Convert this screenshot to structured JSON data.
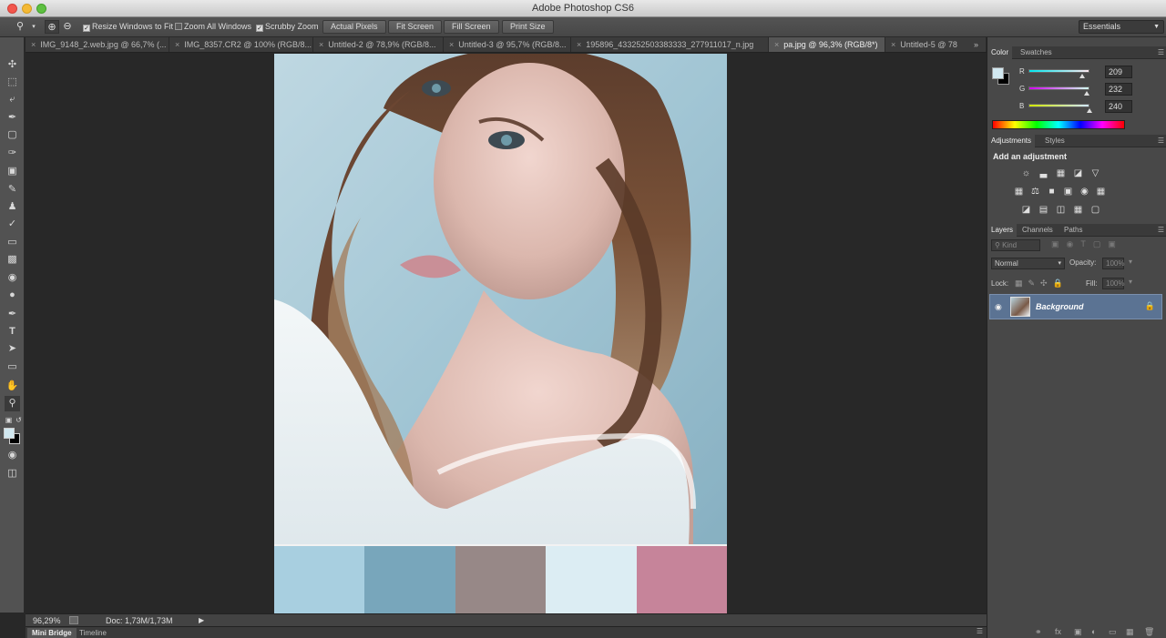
{
  "window": {
    "title": "Adobe Photoshop CS6"
  },
  "options": {
    "resize_windows": "Resize Windows to Fit",
    "zoom_all_windows": "Zoom All Windows",
    "scrubby_zoom": "Scrubby Zoom",
    "actual_pixels": "Actual Pixels",
    "fit_screen": "Fit Screen",
    "fill_screen": "Fill Screen",
    "print_size": "Print Size",
    "workspace": "Essentials"
  },
  "tabs": [
    "IMG_9148_2.web.jpg @ 66,7% (...",
    "IMG_8357.CR2 @ 100% (RGB/8...",
    "Untitled-2 @ 78,9% (RGB/8...",
    "Untitled-3 @ 95,7% (RGB/8...",
    "195896_433252503383333_277911017_n.jpg",
    "pa.jpg @ 96,3% (RGB/8*)",
    "Untitled-5 @ 78"
  ],
  "tabs_overflow": "»",
  "palette": {
    "colors": [
      "#a8cfe0",
      "#78a6bb",
      "#978887",
      "#dcedf3",
      "#c6849a"
    ]
  },
  "status": {
    "zoom": "96,29%",
    "doc": "Doc: 1,73M/1,73M"
  },
  "bottom_tabs": [
    "Mini Bridge",
    "Timeline"
  ],
  "color_panel": {
    "tabs": [
      "Color",
      "Swatches"
    ],
    "r_label": "R",
    "g_label": "G",
    "b_label": "B",
    "r": "209",
    "g": "232",
    "b": "240",
    "foreground": "#d1e8f0"
  },
  "adjustments_panel": {
    "tabs": [
      "Adjustments",
      "Styles"
    ],
    "heading": "Add an adjustment"
  },
  "layers_panel": {
    "tabs": [
      "Layers",
      "Channels",
      "Paths"
    ],
    "filter": "Kind",
    "blend_mode": "Normal",
    "opacity_label": "Opacity:",
    "opacity": "100%",
    "lock_label": "Lock:",
    "fill_label": "Fill:",
    "fill": "100%",
    "layer_name": "Background"
  }
}
